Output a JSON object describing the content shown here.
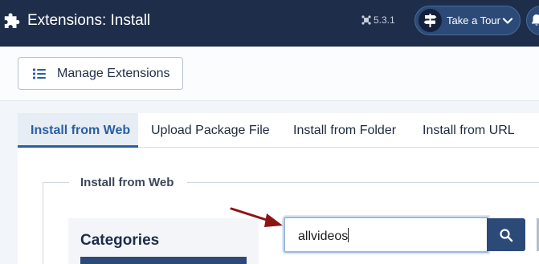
{
  "header": {
    "title": "Extensions: Install",
    "version": "5.3.1",
    "tour_label": "Take a Tour",
    "icons": [
      "puzzle-icon",
      "joomla-icon",
      "signpost-icon",
      "chevron-down-icon",
      "bell-icon"
    ]
  },
  "toolbar": {
    "manage_label": "Manage Extensions"
  },
  "tabs": [
    {
      "label": "Install from Web",
      "active": true
    },
    {
      "label": "Upload Package File",
      "active": false
    },
    {
      "label": "Install from Folder",
      "active": false
    },
    {
      "label": "Install from URL",
      "active": false
    }
  ],
  "web_panel": {
    "legend": "Install from Web",
    "categories_title": "Categories",
    "search_value": "allvideos"
  },
  "colors": {
    "header_bg": "#1d2d4a",
    "accent": "#2a5ea3",
    "button_dark": "#2c4a77",
    "annotation_arrow": "#8b1414"
  }
}
